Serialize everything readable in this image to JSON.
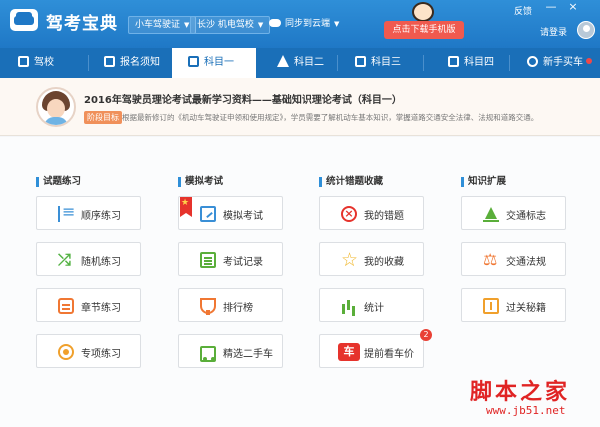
{
  "app": {
    "title": "驾考宝典",
    "car_type_select": "小车驾驶证",
    "city_school_select": "长沙 机电驾校",
    "sync_cloud": "同步到云端",
    "download_button": "点击下载手机版",
    "feedback": "反馈",
    "minimize": "—",
    "close": "×",
    "login": "请登录",
    "brand_color": "#1f78c6",
    "accent_color": "#f05a4f"
  },
  "nav": {
    "items": [
      {
        "label": "驾校",
        "icon": "home-icon"
      },
      {
        "label": "报名须知",
        "icon": "document-icon"
      },
      {
        "label": "科目一",
        "icon": "edit-icon",
        "active": true
      },
      {
        "label": "科目二",
        "icon": "cone-icon"
      },
      {
        "label": "科目三",
        "icon": "car-icon"
      },
      {
        "label": "科目四",
        "icon": "book-icon"
      },
      {
        "label": "新手买车",
        "icon": "steering-wheel-icon",
        "new": true
      }
    ]
  },
  "banner": {
    "title": "2016年驾驶员理论考试最新学习资料——基础知识理论考试（科目一）",
    "badge": "阶段目标",
    "description": "根据最新修订的《机动车驾驶证申领和使用规定》，学员需要了解机动车基本知识，掌握道路交通安全法律、法规和道路交通。"
  },
  "sections": [
    {
      "title": "试题练习",
      "buttons": [
        {
          "label": "顺序练习",
          "icon": "list-icon"
        },
        {
          "label": "随机练习",
          "icon": "shuffle-icon"
        },
        {
          "label": "章节练习",
          "icon": "chapter-icon"
        },
        {
          "label": "专项练习",
          "icon": "target-icon"
        }
      ]
    },
    {
      "title": "模拟考试",
      "buttons": [
        {
          "label": "模拟考试",
          "icon": "exam-edit-icon",
          "ribbon": true
        },
        {
          "label": "考试记录",
          "icon": "record-icon"
        },
        {
          "label": "排行榜",
          "icon": "trophy-icon"
        },
        {
          "label": "精选二手车",
          "icon": "truck-icon"
        }
      ]
    },
    {
      "title": "统计错题收藏",
      "buttons": [
        {
          "label": "我的错题",
          "icon": "wrong-icon"
        },
        {
          "label": "我的收藏",
          "icon": "star-icon"
        },
        {
          "label": "统计",
          "icon": "bar-chart-icon"
        },
        {
          "label": "提前看车价",
          "icon": "car-price-icon",
          "badge": "2",
          "icon_text": "车"
        }
      ]
    },
    {
      "title": "知识扩展",
      "buttons": [
        {
          "label": "交通标志",
          "icon": "traffic-sign-icon"
        },
        {
          "label": "交通法规",
          "icon": "scale-icon"
        },
        {
          "label": "过关秘籍",
          "icon": "guide-book-icon"
        }
      ]
    }
  ],
  "watermark": {
    "text": "脚本之家",
    "url": "www.jb51.net"
  }
}
